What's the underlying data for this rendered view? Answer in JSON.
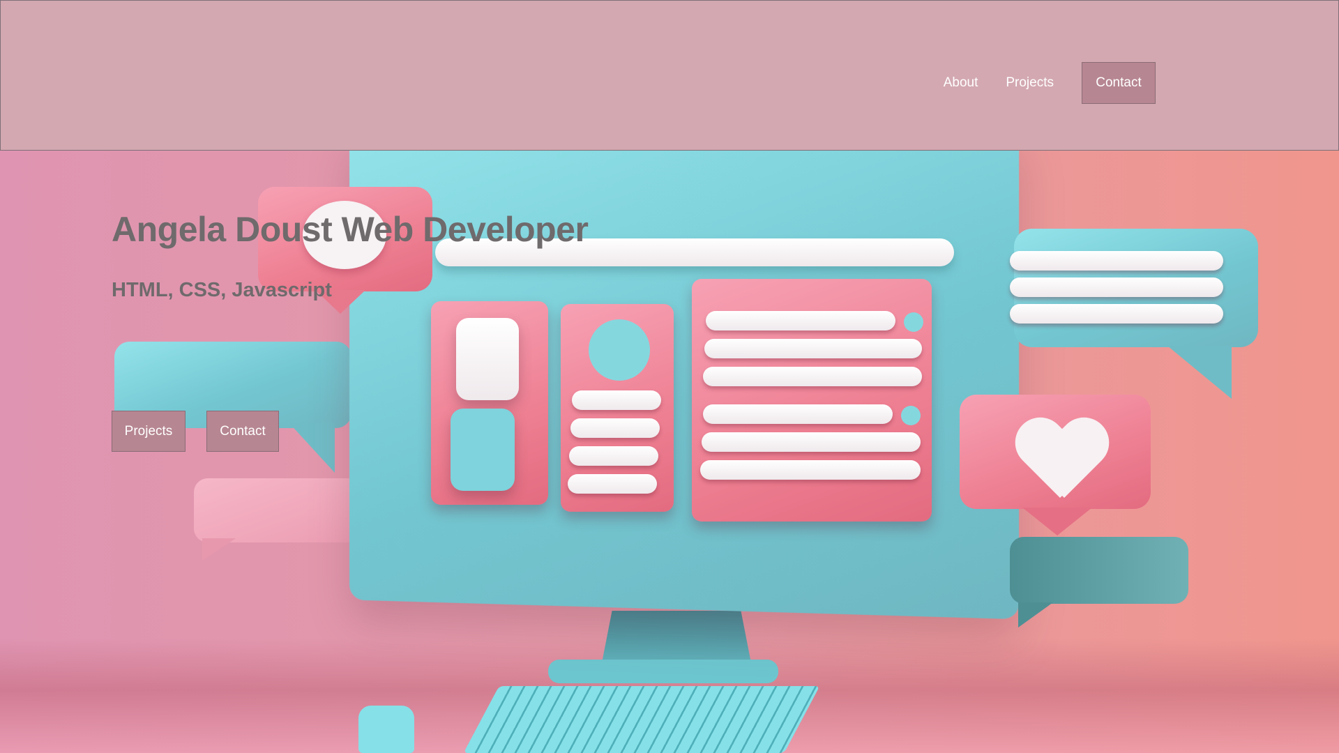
{
  "header": {
    "nav": {
      "about_label": "About",
      "projects_label": "Projects",
      "contact_label": "Contact"
    }
  },
  "hero": {
    "title": "Angela Doust Web Developer",
    "subtitle": "HTML, CSS, Javascript",
    "buttons": {
      "projects_label": "Projects",
      "contact_label": "Contact"
    },
    "illustration": "computer-monitor-with-chat-bubbles"
  },
  "colors": {
    "header_bg": "#d3a8b1",
    "button_bg": "#b68692",
    "heading_text": "#6f6a6c",
    "teal": "#7fd3dc",
    "pink": "#ee7f92"
  }
}
